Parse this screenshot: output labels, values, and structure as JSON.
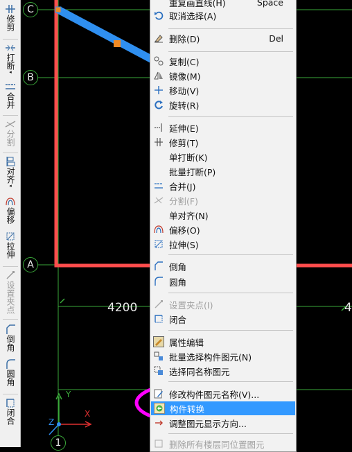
{
  "toolbar": {
    "items": [
      {
        "label": "修剪"
      },
      {
        "label": "打断"
      },
      {
        "label": "合并"
      },
      {
        "label": "分割"
      },
      {
        "label": "对齐"
      },
      {
        "label": "偏移"
      },
      {
        "label": "拉伸"
      },
      {
        "label": "设置夹点"
      },
      {
        "label": "倒角"
      },
      {
        "label": "圆角"
      },
      {
        "label": "闭合"
      }
    ]
  },
  "canvas": {
    "axes": {
      "c": "C",
      "b": "B",
      "a": "A",
      "one": "1"
    },
    "dimension": {
      "left": "4200",
      "right": "4"
    },
    "ucs": {
      "y": "Y",
      "x": "X",
      "z": "Z"
    },
    "colors": {
      "background": "#000000",
      "wall": "#ff4d4d",
      "beam": "#2f8ff0",
      "grip": "#f08a24",
      "axis": "#3aa83a",
      "highlight_ring": "#ff00ff"
    }
  },
  "menu": {
    "items": [
      {
        "label": "重复画直线(H)",
        "shortcut": "Space"
      },
      {
        "label": "取消选择(A)",
        "shortcut": ""
      },
      {
        "label": "删除(D)",
        "shortcut": "Del"
      },
      {
        "label": "复制(C)",
        "shortcut": ""
      },
      {
        "label": "镜像(M)",
        "shortcut": ""
      },
      {
        "label": "移动(V)",
        "shortcut": ""
      },
      {
        "label": "旋转(R)",
        "shortcut": ""
      },
      {
        "label": "延伸(E)",
        "shortcut": ""
      },
      {
        "label": "修剪(T)",
        "shortcut": ""
      },
      {
        "label": "单打断(K)",
        "shortcut": ""
      },
      {
        "label": "批量打断(P)",
        "shortcut": ""
      },
      {
        "label": "合并(J)",
        "shortcut": ""
      },
      {
        "label": "分割(F)",
        "shortcut": ""
      },
      {
        "label": "单对齐(N)",
        "shortcut": ""
      },
      {
        "label": "偏移(O)",
        "shortcut": ""
      },
      {
        "label": "拉伸(S)",
        "shortcut": ""
      },
      {
        "label": "倒角",
        "shortcut": ""
      },
      {
        "label": "圆角",
        "shortcut": ""
      },
      {
        "label": "设置夹点(I)",
        "shortcut": ""
      },
      {
        "label": "闭合",
        "shortcut": ""
      },
      {
        "label": "属性编辑",
        "shortcut": ""
      },
      {
        "label": "批量选择构件图元(N)",
        "shortcut": ""
      },
      {
        "label": "选择同名称图元",
        "shortcut": ""
      },
      {
        "label": "修改构件图元名称(V)...",
        "shortcut": ""
      },
      {
        "label": "构件转换",
        "shortcut": ""
      },
      {
        "label": "调整图元显示方向...",
        "shortcut": ""
      },
      {
        "label": "删除所有楼层同位置图元",
        "shortcut": ""
      }
    ]
  }
}
